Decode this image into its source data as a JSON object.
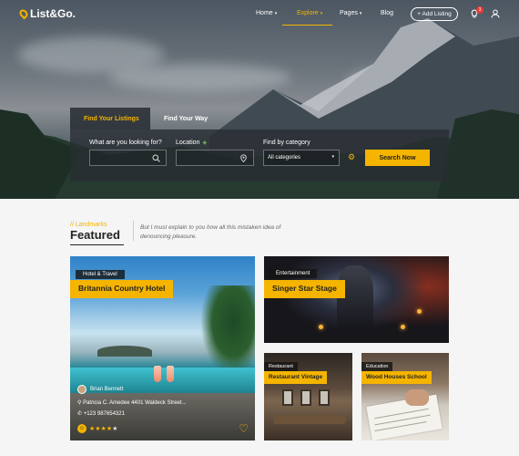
{
  "brand": {
    "logo_text": "List&Go."
  },
  "nav": {
    "items": [
      {
        "label": "Home",
        "has_caret": true
      },
      {
        "label": "Explore",
        "has_caret": true,
        "active": true
      },
      {
        "label": "Pages",
        "has_caret": true
      },
      {
        "label": "Blog",
        "has_caret": false
      }
    ],
    "add_listing_label": "+ Add Listing",
    "notification_count": "3"
  },
  "search": {
    "tabs": [
      "Find Your Listings",
      "Find Your Way"
    ],
    "what_label": "What are you looking for?",
    "location_label": "Location",
    "category_label": "Find by category",
    "category_selected": "All categories",
    "button_label": "Search Now"
  },
  "featured": {
    "subtitle": "// Landmarks",
    "title": "Featured",
    "description": "But I must explain to you how all this mistaken idea of denouncing pleasure."
  },
  "cards": [
    {
      "category": "Hotel & Travel",
      "title": "Britannia Country Hotel",
      "author": "Brian Bennett",
      "address": "Patricia C. Amedee 4401 Waldeck Street...",
      "phone": "+123 987654321",
      "rating": 4,
      "rating_max": 5
    },
    {
      "category": "Entertainment",
      "title": "Singer Star Stage"
    },
    {
      "category": "Restaurant",
      "title": "Restaurant Vintage"
    },
    {
      "category": "Education",
      "title": "Wood Houses School"
    }
  ],
  "colors": {
    "accent": "#f4b400",
    "dark_overlay": "#282d32",
    "badge": "#e53935"
  }
}
